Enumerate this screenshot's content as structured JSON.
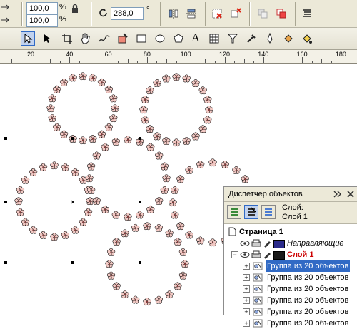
{
  "propbar": {
    "scale_w": "100,0",
    "scale_h": "100,0",
    "pct1": "%",
    "pct2": "%",
    "rotation": "288,0",
    "deg": "°"
  },
  "ruler": {
    "labels": [
      "20",
      "40",
      "60",
      "80",
      "100",
      "120",
      "140",
      "160",
      "180"
    ]
  },
  "docker": {
    "title": "Диспетчер объектов",
    "layer_prefix": "Слой:",
    "layer_current": "Слой 1",
    "page": "Страница 1",
    "guides_layer": "Направляющие",
    "layer1": "Слой 1",
    "groups": [
      "Группа из 20 объектов",
      "Группа из 20 объектов",
      "Группа из 20 объектов",
      "Группа из 20 объектов",
      "Группа из 20 объектов",
      "Группа из 20 объектов"
    ]
  },
  "colors": {
    "petal": "#f2c9c4",
    "outline": "#000000",
    "selection": "#316ac5",
    "guides_swatch": "#2a2a8a",
    "layer1_swatch": "#1a1a1a",
    "layer1_text": "#cc0000"
  },
  "icons": [
    "lock-icon",
    "rotate-icon",
    "mirror-h-icon",
    "mirror-v-icon",
    "delete-icon",
    "group-icon",
    "ungroup-icon",
    "options-icon",
    "pick-tool-icon",
    "shape-tool-icon",
    "crop-tool-icon",
    "pan-tool-icon",
    "freehand-tool-icon",
    "smart-fill-icon",
    "rectangle-tool-icon",
    "ellipse-tool-icon",
    "polygon-tool-icon",
    "text-tool-icon",
    "table-tool-icon",
    "blend-tool-icon",
    "eyedropper-icon",
    "outline-tool-icon",
    "fill-tool-icon",
    "interactive-fill-icon"
  ]
}
